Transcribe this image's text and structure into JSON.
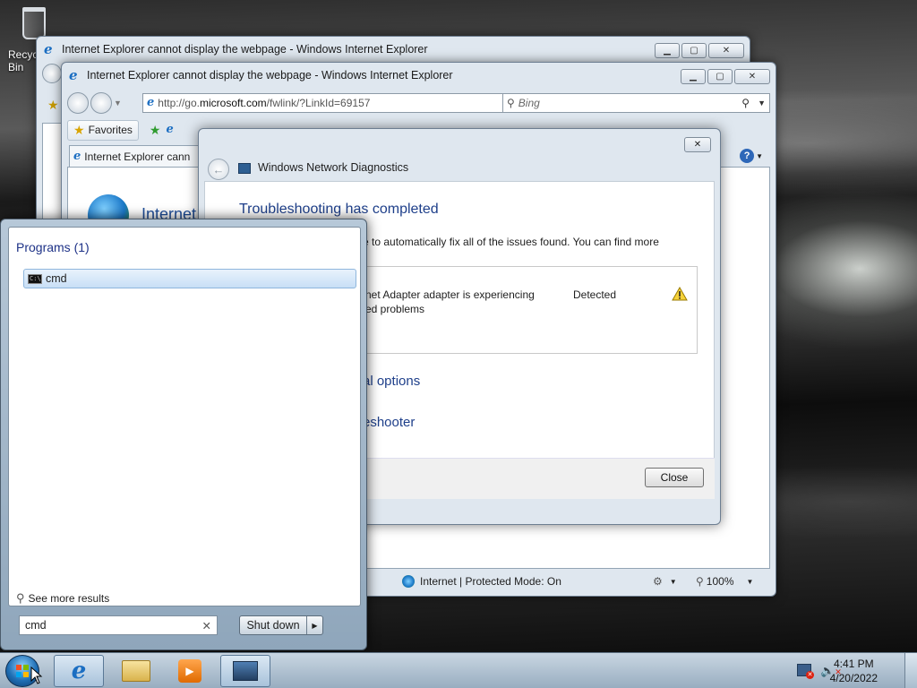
{
  "desktop": {
    "recycle_bin_label": "Recycle Bin"
  },
  "ie_window_back": {
    "title": "Internet Explorer cannot display the webpage - Windows Internet Explorer"
  },
  "ie_window_front": {
    "title": "Internet Explorer cannot display the webpage - Windows Internet Explorer",
    "address_prefix": "http://go.",
    "address_domain": "microsoft.com",
    "address_suffix": "/fwlink/?LinkId=69157",
    "search_placeholder": "Bing",
    "favorites_label": "Favorites",
    "tab_title": "Internet Explorer cann",
    "page_heading_partial": "Internet",
    "status_zone": "Internet | Protected Mode: On",
    "zoom": "100%"
  },
  "diagnostics": {
    "title": "Windows Network Diagnostics",
    "heading": "Troubleshooting has completed",
    "summary_partial": "e to automatically fix all of the issues found. You can find more",
    "issue_line1": "net Adapter adapter is experiencing",
    "issue_line2": "ed problems",
    "issue_status": "Detected",
    "option1_partial": "al options",
    "option2_partial": "eshooter",
    "close_button": "Close"
  },
  "start_menu": {
    "programs_header": "Programs (1)",
    "program_item": "cmd",
    "see_more": "See more results",
    "search_value": "cmd",
    "shutdown_label": "Shut down"
  },
  "taskbar": {
    "time": "4:41 PM",
    "date": "4/20/2022"
  },
  "icons": {
    "ie": "internet-explorer-icon",
    "explorer": "folder-icon",
    "media": "media-player-icon",
    "network": "network-icon",
    "warning": "warning-icon"
  }
}
